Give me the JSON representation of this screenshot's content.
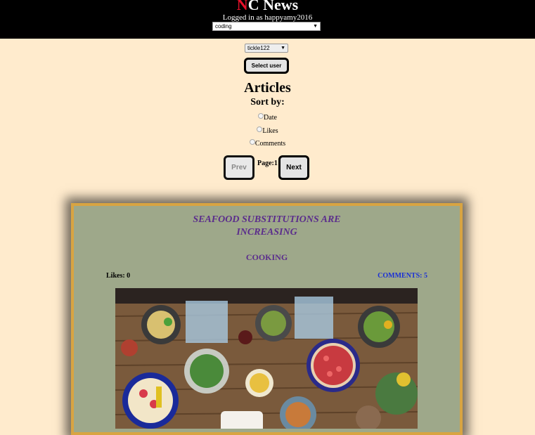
{
  "header": {
    "logo_first_letter": "N",
    "logo_rest": "C News",
    "logged_in_text": "Logged in as happyamy2016",
    "topic_select_value": "coding"
  },
  "user_picker": {
    "selected_user": "tickle122",
    "select_button_label": "Select user"
  },
  "articles": {
    "title": "Articles",
    "sort_by_label": "Sort by:",
    "sort_options": [
      "Date",
      "Likes",
      "Comments"
    ]
  },
  "pagination": {
    "prev_label": "Prev",
    "next_label": "Next",
    "page_text": "Page:1"
  },
  "article_card": {
    "title_line1": "SEAFOOD SUBSTITUTIONS ARE",
    "title_line2": "INCREASING",
    "topic": "COOKING",
    "likes_text": "Likes: 0",
    "comments_text": "COMMENTS: 5",
    "image_description_icon": "food-table-photo"
  },
  "colors": {
    "page_background": "#ffebcd",
    "header_background": "#000000",
    "logo_accent": "#e8102a",
    "card_background": "#9ea88a",
    "card_border": "#d8a442",
    "card_text_purple": "#5b2d8c",
    "comments_blue": "#1a2fd6"
  }
}
